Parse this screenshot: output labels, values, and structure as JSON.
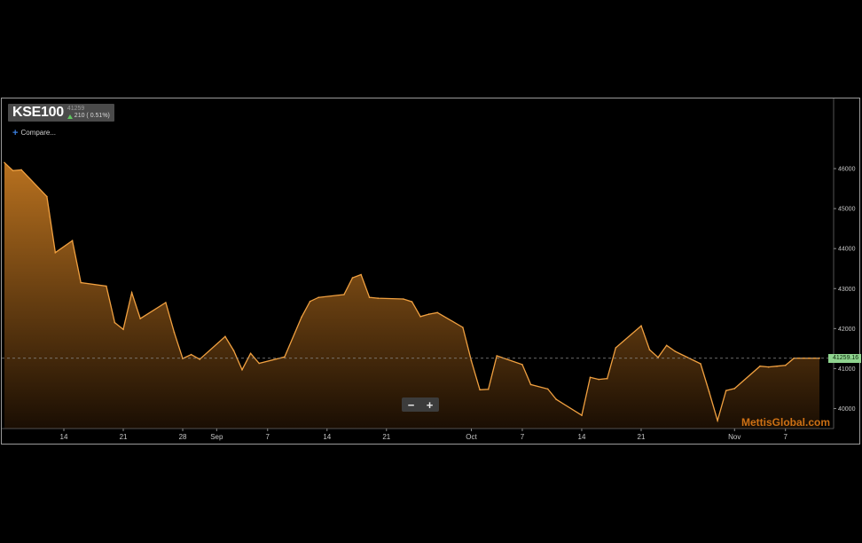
{
  "ticker": {
    "symbol": "KSE100",
    "last": "41259",
    "change": "210 ( 0.51%)",
    "change_direction": "up-arrow-icon"
  },
  "compare_label": "Compare...",
  "zoom": {
    "minus_label": "−",
    "plus_label": "+"
  },
  "watermark": "MettisGlobal.com",
  "last_price_label": "41259.16",
  "colors": {
    "line": "#f0a040",
    "fill_top": "#b8711f",
    "fill_bottom": "#1a0e03",
    "up": "#5ec85e",
    "last_price_tag": "#8fd48f"
  },
  "chart_data": {
    "type": "area",
    "title": "KSE100",
    "ylim": [
      39500,
      46600
    ],
    "y_ticks": [
      40000,
      41000,
      42000,
      43000,
      44000,
      45000,
      46000
    ],
    "y_tick_labels": [
      "40000",
      "41000",
      "42000",
      "43000",
      "44000",
      "45000",
      "46000"
    ],
    "x_tick_labels": [
      "14",
      "21",
      "28",
      "Sep",
      "7",
      "14",
      "21",
      "Oct",
      "7",
      "14",
      "21",
      "Nov",
      "7"
    ],
    "x_tick_dates": [
      "2019-08-14",
      "2019-08-21",
      "2019-08-28",
      "2019-09-01",
      "2019-09-07",
      "2019-09-14",
      "2019-09-21",
      "2019-10-01",
      "2019-10-07",
      "2019-10-14",
      "2019-10-21",
      "2019-11-01",
      "2019-11-07"
    ],
    "last_value": 41259.16,
    "series": [
      {
        "dates": [
          "2019-08-07",
          "2019-08-08",
          "2019-08-09",
          "2019-08-12",
          "2019-08-13",
          "2019-08-15",
          "2019-08-16",
          "2019-08-19",
          "2019-08-20",
          "2019-08-21",
          "2019-08-22",
          "2019-08-23",
          "2019-08-26",
          "2019-08-27",
          "2019-08-28",
          "2019-08-29",
          "2019-08-30",
          "2019-09-02",
          "2019-09-03",
          "2019-09-04",
          "2019-09-05",
          "2019-09-06",
          "2019-09-09",
          "2019-09-11",
          "2019-09-12",
          "2019-09-13",
          "2019-09-16",
          "2019-09-17",
          "2019-09-18",
          "2019-09-19",
          "2019-09-20",
          "2019-09-23",
          "2019-09-24",
          "2019-09-25",
          "2019-09-26",
          "2019-09-27",
          "2019-09-30",
          "2019-10-01",
          "2019-10-02",
          "2019-10-03",
          "2019-10-04",
          "2019-10-07",
          "2019-10-08",
          "2019-10-10",
          "2019-10-11",
          "2019-10-14",
          "2019-10-15",
          "2019-10-16",
          "2019-10-17",
          "2019-10-18",
          "2019-10-21",
          "2019-10-22",
          "2019-10-23",
          "2019-10-24",
          "2019-10-25",
          "2019-10-28",
          "2019-10-29",
          "2019-10-30",
          "2019-10-31",
          "2019-11-01",
          "2019-11-04",
          "2019-11-05",
          "2019-11-06",
          "2019-11-07",
          "2019-11-08",
          "2019-11-11"
        ],
        "values": [
          46150,
          45950,
          45970,
          45300,
          43900,
          44200,
          43150,
          43060,
          42150,
          41980,
          42900,
          42250,
          42650,
          41900,
          41250,
          41350,
          41230,
          41800,
          41450,
          40970,
          41380,
          41130,
          41290,
          42290,
          42680,
          42780,
          42850,
          43270,
          43350,
          42780,
          42760,
          42740,
          42670,
          42300,
          42360,
          42400,
          42030,
          41190,
          40470,
          40480,
          41320,
          41100,
          40600,
          40490,
          40230,
          39830,
          40780,
          40730,
          40750,
          41520,
          42070,
          41470,
          41280,
          41580,
          41430,
          41120,
          40420,
          39700,
          40450,
          40500,
          41060,
          41040,
          41060,
          41080,
          41259,
          41259.16
        ]
      }
    ]
  }
}
